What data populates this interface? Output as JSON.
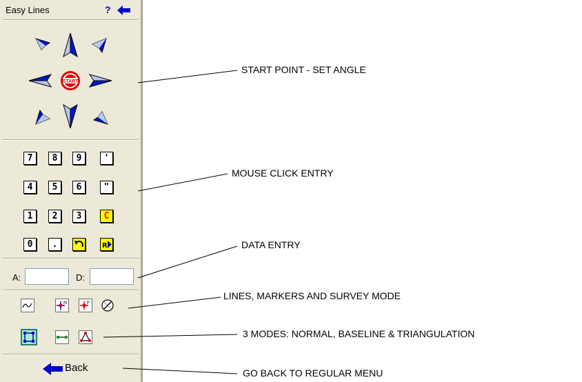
{
  "panel": {
    "title": "Easy Lines",
    "help_label": "?",
    "help_icon": "question-mark-icon",
    "pin_icon": "back-arrow-icon",
    "start_label": "START",
    "keypad": {
      "row1": [
        "7",
        "8",
        "9",
        "'"
      ],
      "row2": [
        "4",
        "5",
        "6",
        "\""
      ],
      "row3": [
        "1",
        "2",
        "3",
        "C"
      ],
      "row4": [
        "0",
        "."
      ]
    },
    "angle_label": "A:",
    "distance_label": "D:",
    "angle_value": "",
    "distance_value": "",
    "back_label": "Back"
  },
  "callouts": {
    "start_point": "START POINT - SET ANGLE",
    "mouse_click": "MOUSE CLICK ENTRY",
    "data_entry": "DATA ENTRY",
    "lines_markers": "LINES, MARKERS AND SURVEY MODE",
    "modes": "3 MODES: NORMAL, BASELINE & TRIANGULATION",
    "go_back": "GO BACK TO REGULAR MENU"
  },
  "colors": {
    "panel_bg": "#ece9d8",
    "arrow_blue": "#0018c8",
    "highlight_yellow": "#ffff00",
    "active_mode": "#a6efc7"
  }
}
